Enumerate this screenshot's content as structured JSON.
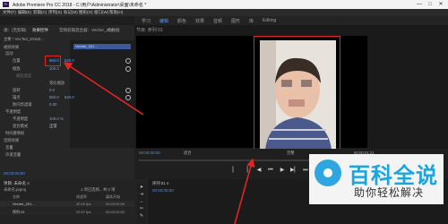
{
  "window": {
    "title": "Adobe Premiere Pro CC 2018 - C:\\用户\\Administrator\\桌面\\未命名 *",
    "logo_text": "Pr",
    "buttons": [
      "—",
      "□",
      "✕"
    ]
  },
  "menu": [
    "文件(F)",
    "编辑(E)",
    "剪辑(C)",
    "序列(S)",
    "标记(M)",
    "图形(G)",
    "窗口(W)",
    "帮助(H)"
  ],
  "workspace_tabs": [
    {
      "label": "学习",
      "active": false
    },
    {
      "label": "组件",
      "active": false
    },
    {
      "label": "编辑",
      "active": true
    },
    {
      "label": "颜色",
      "active": false
    },
    {
      "label": "效果",
      "active": false
    },
    {
      "label": "音频",
      "active": false
    },
    {
      "label": "图形",
      "active": false
    },
    {
      "label": "库",
      "active": false
    },
    {
      "label": "Editing",
      "active": false
    }
  ],
  "left_panel": {
    "tabs": [
      {
        "label": "源：(无剪辑)",
        "active": false
      },
      {
        "label": "效果控件",
        "active": true
      },
      {
        "label": "音频剪辑混合器：Vecher_201",
        "active": false
      },
      {
        "label": "元数据",
        "active": false
      }
    ],
    "source_label": "主要 * VecTed_20160...",
    "clip_label": "Vecher_201...",
    "section_video": "视频效果",
    "fx_motion": "运动",
    "rows": [
      {
        "label": "位置",
        "value": "960.0",
        "value2": "540.0"
      },
      {
        "label": "缩放",
        "value": "100.0"
      },
      {
        "label": "缩放宽度",
        "value": ""
      },
      {
        "label": "等比缩放",
        "value": "☑"
      },
      {
        "label": "旋转",
        "value": "0.0"
      },
      {
        "label": "锚点",
        "value": "960.0",
        "value2": "540.0"
      },
      {
        "label": "防闪烁滤镜",
        "value": "0.00"
      },
      {
        "label": "不透明度",
        "value": ""
      },
      {
        "label": "不透明度",
        "value": "100.0 %"
      },
      {
        "label": "混合模式",
        "value": "正常"
      },
      {
        "label": "时间重映射",
        "value": ""
      }
    ],
    "section_audio": "音频效果",
    "fx_volume": "音量",
    "fx_channel": "声道音量",
    "timecode": "00;00;00;00"
  },
  "program_monitor": {
    "header": "节目: 序列 01",
    "timecode_left": "00:00:00:00",
    "timecode_right": "00:00:01:21",
    "fit": "适合",
    "quality": "完整"
  },
  "project_panel": {
    "header": "项目: 未命名 ≡",
    "file": "未命名.prproj",
    "columns": [
      "名称",
      "帧速率",
      "媒体开始"
    ],
    "items": [
      {
        "name": "Vecher_201...",
        "fps": "30.00 fps",
        "start": "00;00;00;00"
      },
      {
        "name": "序列 01",
        "fps": "29.97 fps",
        "start": "00;00;00;00"
      }
    ],
    "items_count": "1 项已选择，共 2 项"
  },
  "timeline": {
    "header": "序列 01 ≡",
    "timecode": "00;00;00;00"
  },
  "watermark": {
    "title": "百科全说",
    "subtitle": "助你轻松解决"
  },
  "colors": {
    "accent": "#5b9bf2",
    "highlight": "#e02525",
    "keyframe_value": "#5ea4ff"
  }
}
